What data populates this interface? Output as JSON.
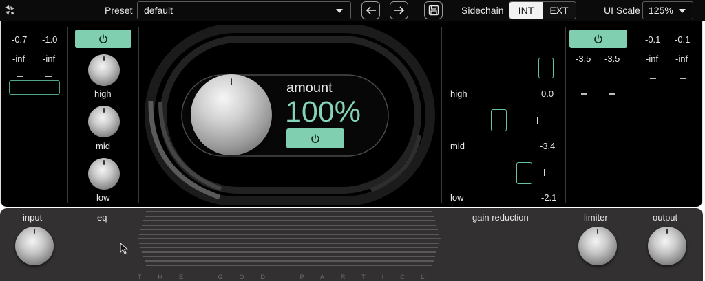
{
  "topbar": {
    "preset_label": "Preset",
    "preset_value": "default",
    "sidechain_label": "Sidechain",
    "sidechain_options": [
      "INT",
      "EXT"
    ],
    "sidechain_selected": "INT",
    "ui_scale_label": "UI Scale",
    "ui_scale_value": "125%",
    "icons": [
      "logo-icon",
      "arrow-left-icon",
      "arrow-right-icon",
      "save-icon"
    ]
  },
  "input_meter": {
    "peak_l": "-0.7",
    "peak_r": "-1.0",
    "rms_l": "-inf",
    "rms_r": "-inf"
  },
  "eq": {
    "bands": [
      "high",
      "mid",
      "low"
    ]
  },
  "center": {
    "amount_label": "amount",
    "amount_value": "100%"
  },
  "gain_reduction": {
    "bands": [
      {
        "label": "high",
        "value": "0.0"
      },
      {
        "label": "mid",
        "value": "-3.4"
      },
      {
        "label": "low",
        "value": "-2.1"
      }
    ]
  },
  "limiter_meter": {
    "l": "-3.5",
    "r": "-3.5"
  },
  "output_meter": {
    "peak_l": "-0.1",
    "peak_r": "-0.1",
    "rms_l": "-inf",
    "rms_r": "-inf"
  },
  "bottom": {
    "labels": {
      "input": "input",
      "eq": "eq",
      "gain_reduction": "gain reduction",
      "limiter": "limiter",
      "output": "output"
    },
    "brand_text": "THE GOD PARTICLE"
  },
  "colors": {
    "accent": "#7fcfb0",
    "panel_bg": "#000000",
    "bottom_bg": "#323030"
  }
}
